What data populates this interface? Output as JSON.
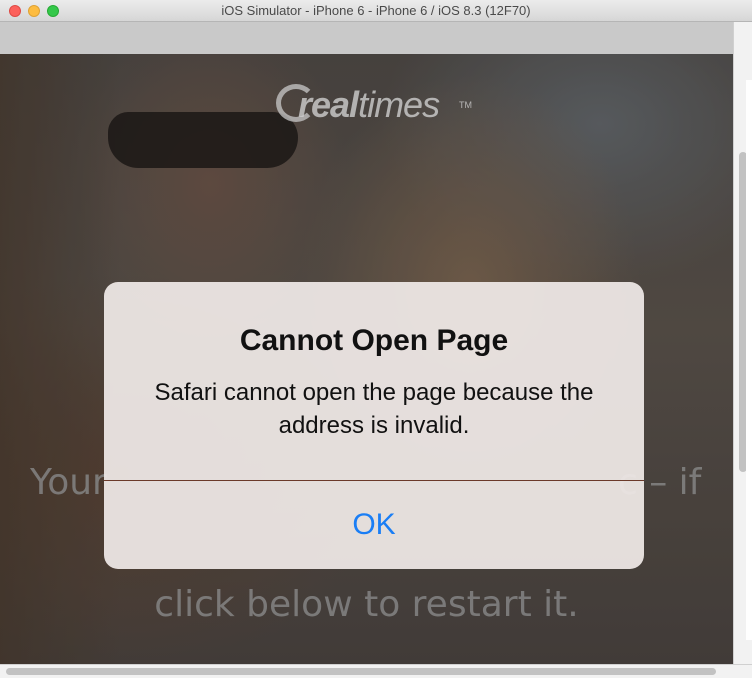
{
  "window": {
    "title": "iOS Simulator - iPhone 6 - iPhone 6 / iOS 8.3 (12F70)"
  },
  "page": {
    "logo_bold": "real",
    "logo_light": "times",
    "logo_tm": "TM",
    "background_text_left": "Your",
    "background_text_right": "c – if",
    "background_text_line2": "click below to restart it."
  },
  "alert": {
    "title": "Cannot Open Page",
    "message": "Safari cannot open the page because the address is invalid.",
    "ok_label": "OK"
  },
  "colors": {
    "alert_button": "#1a7ef5",
    "alert_background": "#eee8e6"
  }
}
